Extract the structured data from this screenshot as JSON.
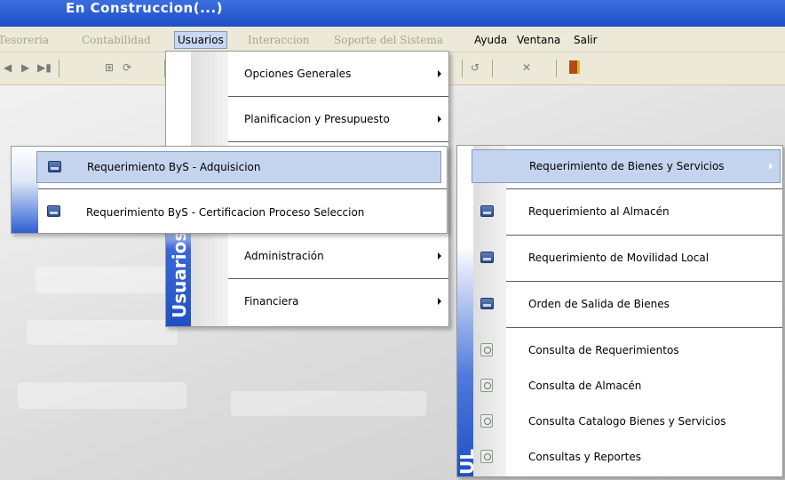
{
  "window": {
    "title": "En Construccion(...)"
  },
  "menubar": {
    "items": [
      {
        "label": "Tesoreria",
        "state": "disabled"
      },
      {
        "label": "Contabilidad",
        "state": "disabled"
      },
      {
        "label": "Usuarios",
        "state": "active"
      },
      {
        "label": "Interaccion",
        "state": "disabled"
      },
      {
        "label": "Soporte del Sistema",
        "state": "disabled"
      },
      {
        "label": "Ayuda",
        "state": "normal"
      },
      {
        "label": "Ventana",
        "state": "normal"
      },
      {
        "label": "Salir",
        "state": "normal"
      }
    ]
  },
  "toolbar": {
    "buttons": [
      {
        "glyph": "◀",
        "icon": "prev-icon"
      },
      {
        "glyph": "▶",
        "icon": "next-icon"
      },
      {
        "glyph": "▶▮",
        "icon": "last-icon"
      },
      {
        "glyph": "⊞",
        "icon": "grid-icon"
      },
      {
        "glyph": "⟳",
        "icon": "refresh-icon"
      },
      {
        "glyph": "↺",
        "icon": "undo-icon"
      },
      {
        "glyph": "✕",
        "icon": "close-icon"
      }
    ]
  },
  "menu_usuarios": {
    "side_label": "Usuarios",
    "items": [
      {
        "label": "Opciones Generales"
      },
      {
        "label": "Planificacion y Presupuesto"
      },
      {
        "label": "Administración"
      },
      {
        "label": "Financiera"
      }
    ]
  },
  "submenu_bys": {
    "items": [
      {
        "label": "Requerimiento ByS - Adquisicion",
        "icon": "document-icon"
      },
      {
        "label": "Requerimiento ByS - Certificacion Proceso Seleccion",
        "icon": "document-icon"
      }
    ]
  },
  "submenu_ul": {
    "side_label": "UL",
    "items": [
      {
        "label": "Requerimiento de Bienes y Servicios",
        "icon": "",
        "has_submenu": true
      },
      {
        "label": "Requerimiento al Almacén",
        "icon": "document-icon"
      },
      {
        "label": "Requerimiento de Movilidad Local",
        "icon": "document-icon"
      },
      {
        "label": "Orden de Salida de Bienes",
        "icon": "document-icon"
      },
      {
        "label": "Consulta de Requerimientos",
        "icon": "search-icon"
      },
      {
        "label": "Consulta de Almacén",
        "icon": "search-icon"
      },
      {
        "label": "Consulta Catalogo Bienes y Servicios",
        "icon": "search-icon"
      },
      {
        "label": "Consultas y Reportes",
        "icon": "search-icon"
      }
    ]
  },
  "colors": {
    "titlebar": "#2a5bd0",
    "menubar": "#ece9d8",
    "highlight": "#c5d4ee",
    "side_stripe_blue": "#1f4fc4"
  }
}
